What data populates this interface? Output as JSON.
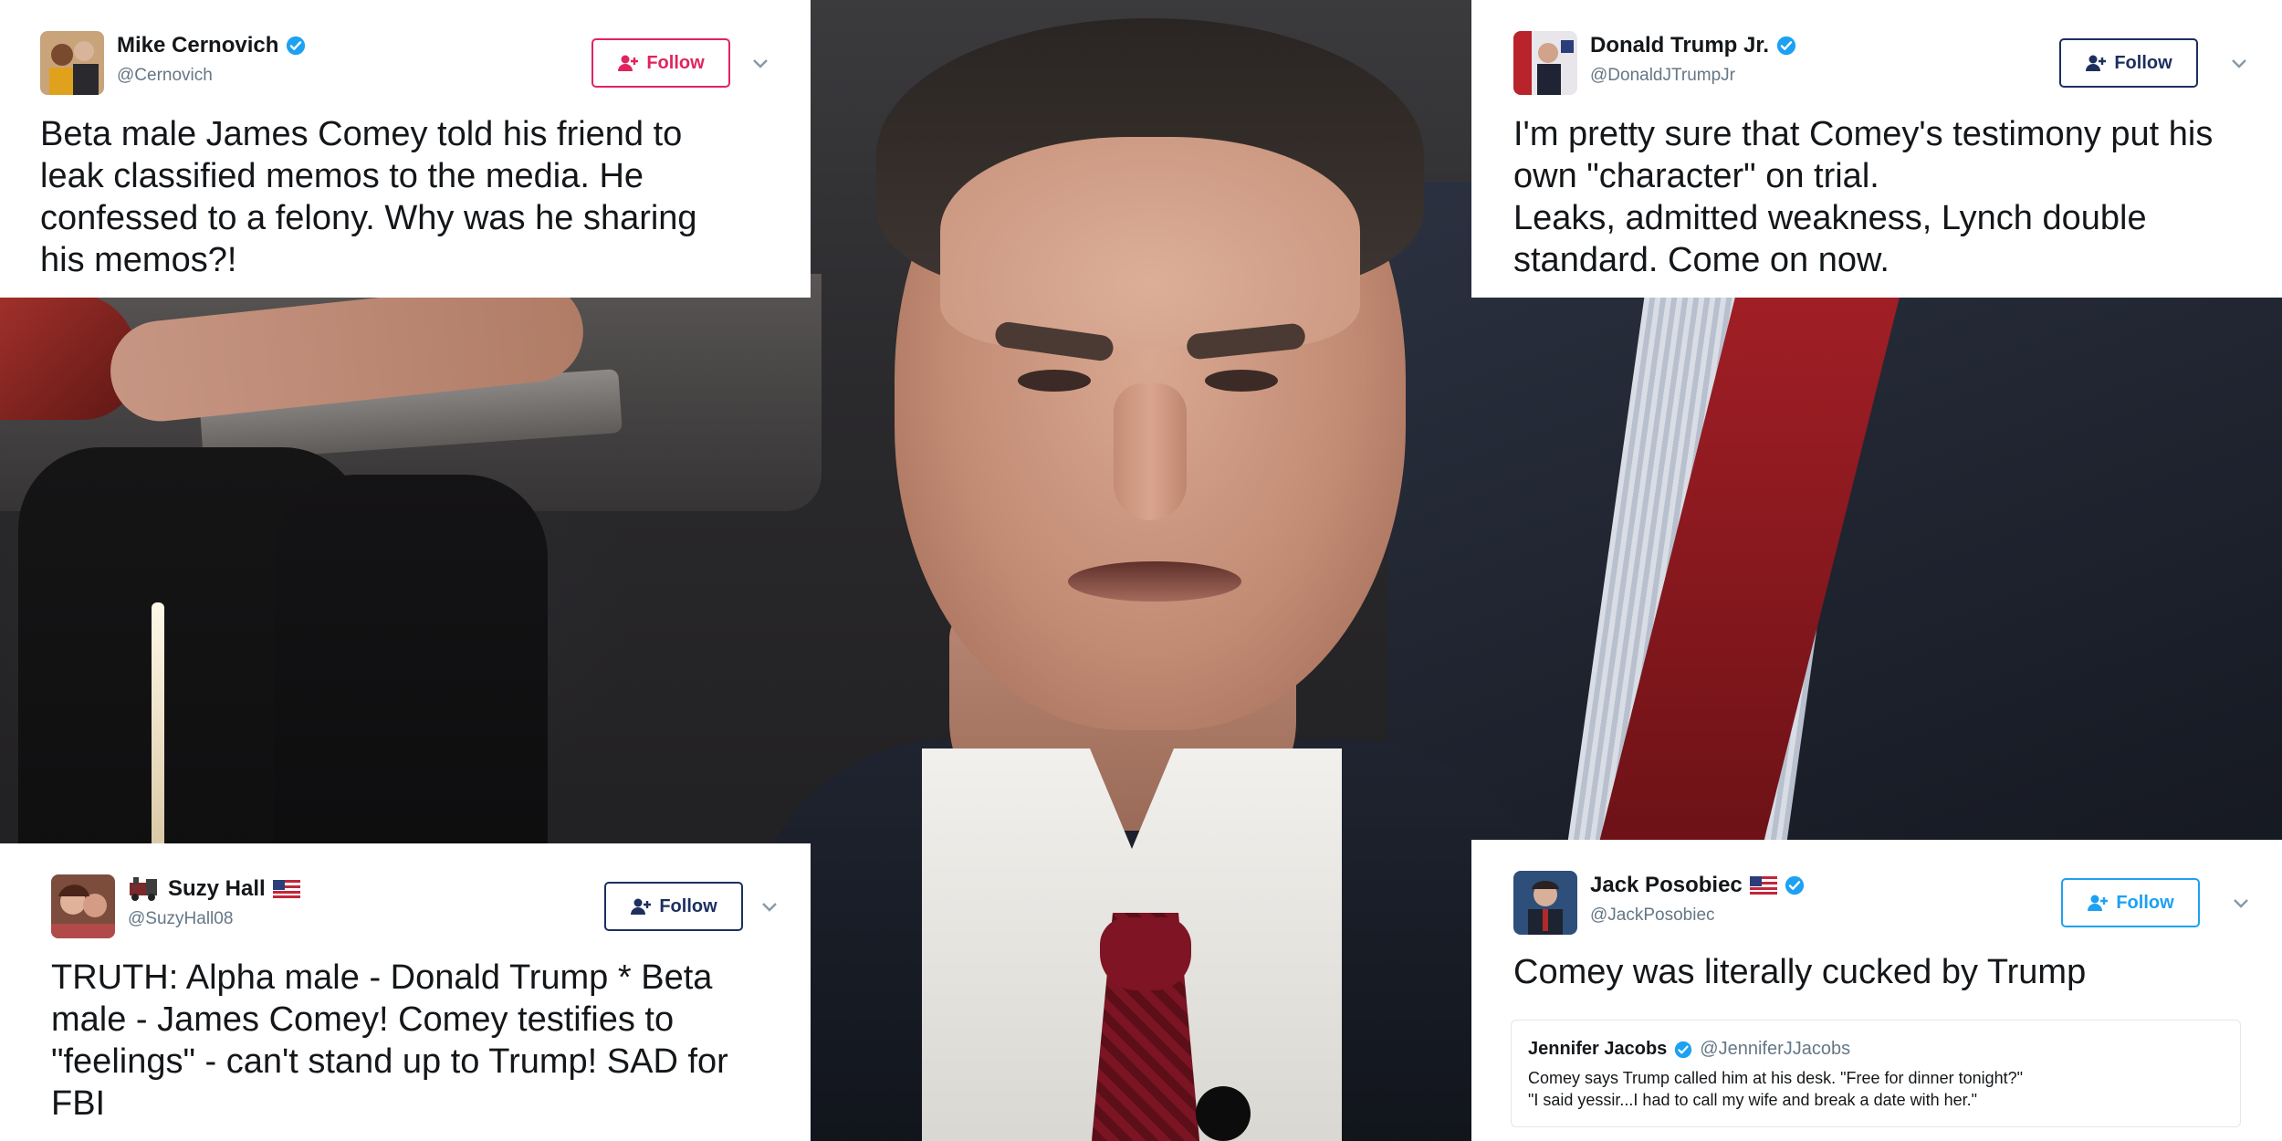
{
  "tweets": [
    {
      "id": "cernovich",
      "name": "Mike Cernovich",
      "handle": "@Cernovich",
      "verified": true,
      "follow_label": "Follow",
      "follow_color": "#e0245e",
      "text": "Beta male James Comey told his friend to\nleak classified memos to the media. He\nconfessed to a felony. Why was he sharing\nhis memos?!"
    },
    {
      "id": "trumpjr",
      "name": "Donald Trump Jr.",
      "handle": "@DonaldJTrumpJr",
      "verified": true,
      "follow_label": "Follow",
      "follow_color": "#1c2f5f",
      "text": "I'm pretty sure that Comey's testimony put his\nown \"character\" on trial.\nLeaks, admitted weakness, Lynch double\nstandard. Come on now."
    },
    {
      "id": "suzyhall",
      "name": "Suzy Hall",
      "handle": "@SuzyHall08",
      "verified": false,
      "follow_label": "Follow",
      "follow_color": "#1c2f5f",
      "text": "TRUTH: Alpha male - Donald Trump * Beta\nmale  - James Comey!  Comey testifies to\n\"feelings\" - can't stand up to Trump! SAD for\nFBI"
    },
    {
      "id": "posobiec",
      "name": "Jack Posobiec",
      "handle": "@JackPosobiec",
      "verified": true,
      "follow_label": "Follow",
      "follow_color": "#1da1f2",
      "text": "Comey was literally cucked by Trump",
      "quote": {
        "name": "Jennifer Jacobs",
        "handle": "@JenniferJJacobs",
        "text": "Comey says Trump called him at his desk. \"Free for dinner tonight?\"\n\"I said yessir...I had to call my wife and break a date with her.\""
      }
    }
  ],
  "colors": {
    "verified_blue": "#1da1f2",
    "text": "#14171a",
    "handle_gray": "#657786"
  },
  "icons": {
    "verified": "verified-badge-icon",
    "follow": "add-user-icon",
    "menu": "chevron-down-icon",
    "flag": "us-flag-icon",
    "train": "train-emoji-icon"
  }
}
